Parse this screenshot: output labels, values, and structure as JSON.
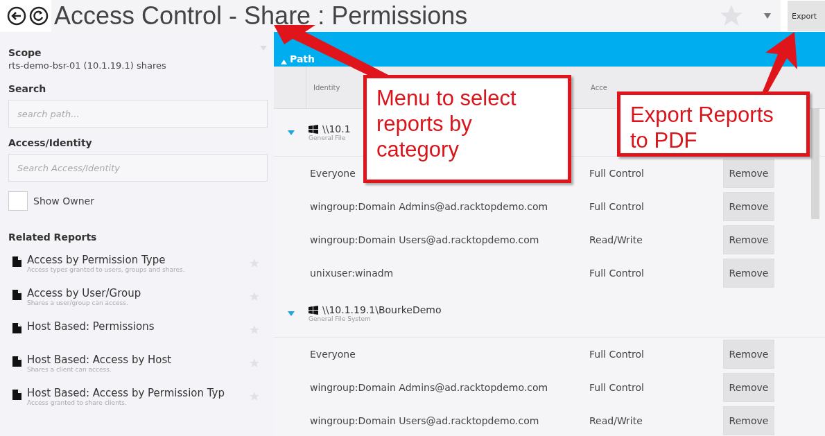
{
  "header": {
    "title": "Access Control - Share : Permissions",
    "favorite": false,
    "export_button": "Export"
  },
  "sidebar": {
    "scope_label": "Scope",
    "scope_value": "rts-demo-bsr-01 (10.1.19.1) shares",
    "search_label": "Search",
    "search_placeholder": "search path...",
    "access_label": "Access/Identity",
    "access_placeholder": "Search Access/Identity",
    "show_owner": {
      "label": "Show Owner",
      "checked": false
    },
    "related_title": "Related Reports",
    "reports": [
      {
        "title": "Access by Permission Type",
        "description": "Access types granted to users, groups and shares.",
        "favorite": false
      },
      {
        "title": "Access by User/Group",
        "description": "Shares a user/group can access.",
        "favorite": false
      },
      {
        "title": "Host Based: Permissions",
        "favorite": false
      },
      {
        "title": "Host Based: Access by Host",
        "description": "Shares a client can access.",
        "favorite": false
      },
      {
        "title": "Host Based: Access by Permission Typ",
        "description": "Access granted to share clients.",
        "favorite": false
      }
    ]
  },
  "table": {
    "banner": "Path",
    "columns": [
      "Identity",
      "Acce"
    ],
    "groups": [
      {
        "path": "\\\\10.1",
        "type": "General File",
        "expanded": true,
        "rows": [
          {
            "identity": "Everyone",
            "access": "Full Control",
            "action": "Remove"
          },
          {
            "identity": "wingroup:Domain Admins@ad.racktopdemo.com",
            "access": "Full Control",
            "action": "Remove"
          },
          {
            "identity": "wingroup:Domain Users@ad.racktopdemo.com",
            "access": "Read/Write",
            "action": "Remove"
          },
          {
            "identity": "unixuser:winadm",
            "access": "Full Control",
            "action": "Remove"
          }
        ]
      },
      {
        "path": "\\\\10.1.19.1\\BourkeDemo",
        "type": "General File System",
        "expanded": true,
        "rows": [
          {
            "identity": "Everyone",
            "access": "Full Control",
            "action": "Remove"
          },
          {
            "identity": "wingroup:Domain Admins@ad.racktopdemo.com",
            "access": "Full Control",
            "action": "Remove"
          },
          {
            "identity": "wingroup:Domain Users@ad.racktopdemo.com",
            "access": "Read/Write",
            "action": "Remove"
          }
        ]
      }
    ]
  },
  "annotations": [
    {
      "text": "Menu to select reports by category"
    },
    {
      "text": "Export Reports to PDF"
    }
  ]
}
